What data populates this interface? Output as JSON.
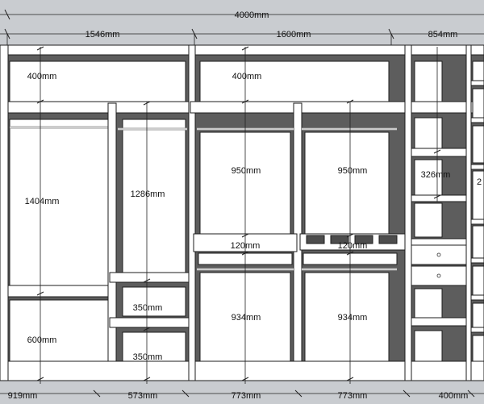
{
  "dimensions": {
    "overall_width": "4000mm",
    "section_widths": [
      "1546mm",
      "1600mm",
      "854mm"
    ],
    "top_shelves": [
      "400mm",
      "400mm"
    ],
    "hanging_heights": [
      "1404mm",
      "1286mm",
      "950mm",
      "950mm",
      "326mm"
    ],
    "drawer_heights": [
      "120mm",
      "120mm"
    ],
    "lower_hanging": [
      "934mm",
      "934mm"
    ],
    "bottom_left": "600mm",
    "small_shelves": [
      "350mm",
      "350mm"
    ],
    "partial_label": "2",
    "bottom_widths": [
      "919mm",
      "573mm",
      "773mm",
      "773mm",
      "400mm"
    ]
  },
  "colors": {
    "background": "#c9ccd0",
    "panel": "#ffffff",
    "interior": "#5d5d5d",
    "line": "#1d1d1d"
  }
}
